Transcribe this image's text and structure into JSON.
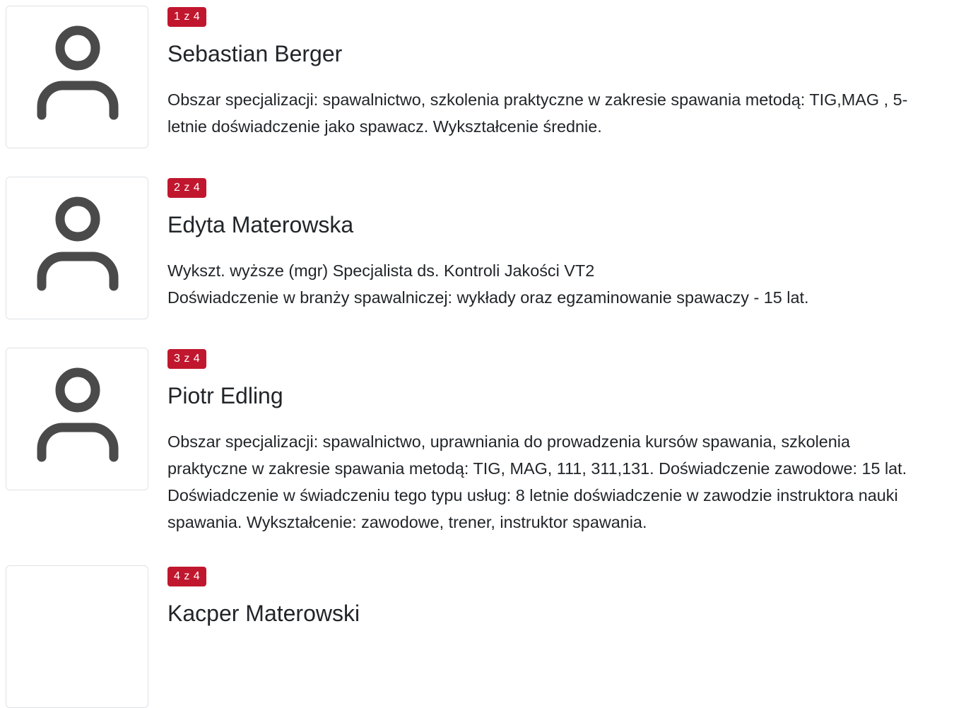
{
  "trainers": [
    {
      "badge": "1 z 4",
      "name": "Sebastian Berger",
      "description_lines": [
        "Obszar specjalizacji: spawalnictwo, szkolenia praktyczne w zakresie spawania metodą: TIG,MAG , 5-",
        "letnie doświadczenie jako spawacz. Wykształcenie średnie."
      ],
      "avatar_icon": "user-icon"
    },
    {
      "badge": "2 z 4",
      "name": "Edyta Materowska",
      "description_lines": [
        "Wykszt. wyższe (mgr) Specjalista ds. Kontroli Jakości VT2",
        "Doświadczenie w branży spawalniczej: wykłady oraz egzaminowanie spawaczy - 15 lat."
      ],
      "avatar_icon": "user-icon"
    },
    {
      "badge": "3 z 4",
      "name": "Piotr Edling",
      "description_lines": [
        "Obszar specjalizacji: spawalnictwo, uprawniania do prowadzenia kursów spawania, szkolenia",
        "praktyczne w zakresie spawania metodą: TIG, MAG, 111, 311,131. Doświadczenie zawodowe: 15 lat.",
        "Doświadczenie w świadczeniu tego typu usług: 8 letnie doświadczenie w zawodzie instruktora nauki",
        "spawania. Wykształcenie: zawodowe, trener, instruktor spawania."
      ],
      "avatar_icon": "user-icon"
    },
    {
      "badge": "4 z 4",
      "name": "Kacper Materowski",
      "description_lines": [],
      "avatar_icon": ""
    }
  ],
  "colors": {
    "badge_bg": "#c0172e",
    "badge_text": "#ffffff",
    "text": "#212529",
    "icon": "#4a4a4a",
    "card_border": "#dee2e6"
  }
}
